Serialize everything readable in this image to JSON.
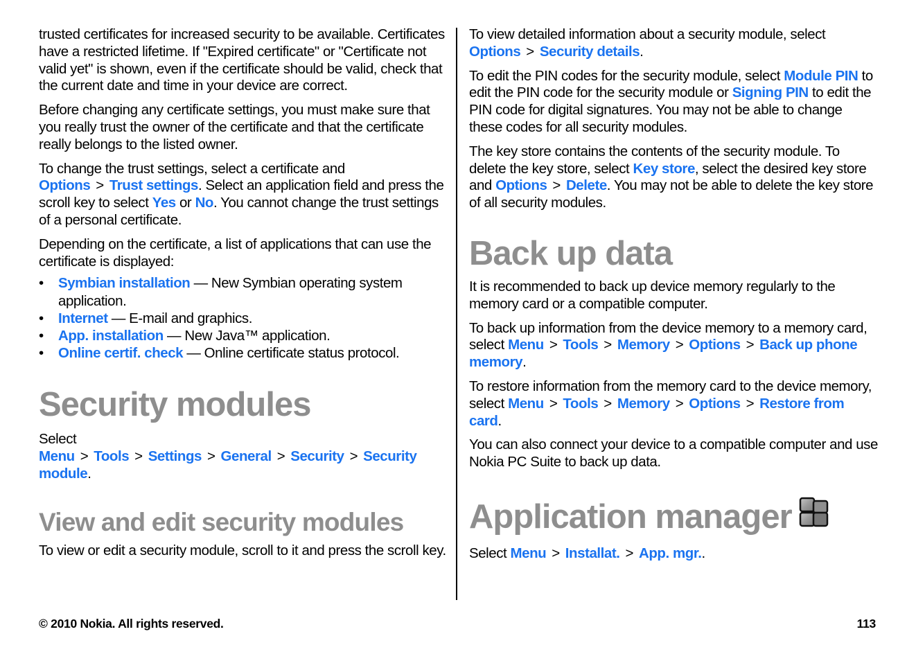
{
  "left_column": {
    "intro_paragraph": "trusted certificates for increased security to be available. Certificates have a restricted lifetime. If \"Expired certificate\" or \"Certificate not valid yet\" is shown, even if the certificate should be valid, check that the current date and time in your device are correct.",
    "before_paragraph": "Before changing any certificate settings, you must make sure that you really trust the owner of the certificate and that the certificate really belongs to the listed owner.",
    "trust_paragraph": {
      "text1": "To change the trust settings, select a certificate and ",
      "link_options": "Options",
      "separator": ">",
      "link_trust_settings": "Trust settings",
      "text2": ". Select an application field and press the scroll key to select ",
      "link_yes": "Yes",
      "text3": " or ",
      "link_no": "No",
      "text4": ". You cannot change the trust settings of a personal certificate."
    },
    "depending_paragraph": "Depending on the certificate, a list of applications that can use the certificate is displayed:",
    "bullet_char": "•",
    "applications": [
      {
        "link": "Symbian installation",
        "desc": " — New Symbian operating system application."
      },
      {
        "link": "Internet",
        "desc": " — E-mail and graphics."
      },
      {
        "link": "App. installation",
        "desc": " — New Java™ application."
      },
      {
        "link": "Online certif. check",
        "desc": " — Online certificate status protocol."
      }
    ],
    "security_modules": {
      "heading": "Security modules",
      "select_prefix": "Select ",
      "path": [
        "Menu",
        "Tools",
        "Settings",
        "General",
        "Security",
        "Security module"
      ],
      "period": "."
    },
    "view_edit": {
      "heading": "View and edit security modules",
      "paragraph": "To view or edit a security module, scroll to it and press the scroll key."
    }
  },
  "right_column": {
    "details_paragraph": {
      "text1": "To view detailed information about a security module, select ",
      "link_options": "Options",
      "link_security_details": "Security details",
      "period": "."
    },
    "pin_paragraph": {
      "text1": "To edit the PIN codes for the security module, select ",
      "link_module_pin": "Module PIN",
      "text2": " to edit the PIN code for the security module or ",
      "link_signing_pin": "Signing PIN",
      "text3": " to edit the PIN code for digital signatures. You may not be able to change these codes for all security modules."
    },
    "keystore_paragraph": {
      "text1": "The key store contains the contents of the security module. To delete the key store, select ",
      "link_key_store": "Key store",
      "text2": ", select the desired key store and ",
      "link_options": "Options",
      "link_delete": "Delete",
      "text3": ". You may not be able to delete the key store of all security modules."
    },
    "backup": {
      "heading": "Back up data",
      "intro": "It is recommended to back up device memory regularly to the memory card or a compatible computer.",
      "backup_text": "To back up information from the device memory to a memory card, select ",
      "backup_path": [
        "Menu",
        "Tools",
        "Memory",
        "Options",
        "Back up phone memory"
      ],
      "restore_text": "To restore information from the memory card to the device memory, select ",
      "restore_path": [
        "Menu",
        "Tools",
        "Memory",
        "Options",
        "Restore from card"
      ],
      "pc_suite": "You can also connect your device to a compatible computer and use Nokia PC Suite to back up data.",
      "period": "."
    },
    "app_manager": {
      "heading": "Application manager",
      "icon": "application-manager-icon",
      "select_prefix": "Select ",
      "path": [
        "Menu",
        "Installat.",
        "App. mgr."
      ],
      "period": "."
    }
  },
  "footer": {
    "copyright": "© 2010 Nokia. All rights reserved.",
    "page_number": "113"
  },
  "colors": {
    "link": "#1a73f0",
    "heading": "#8e8e8e",
    "text": "#000000"
  }
}
